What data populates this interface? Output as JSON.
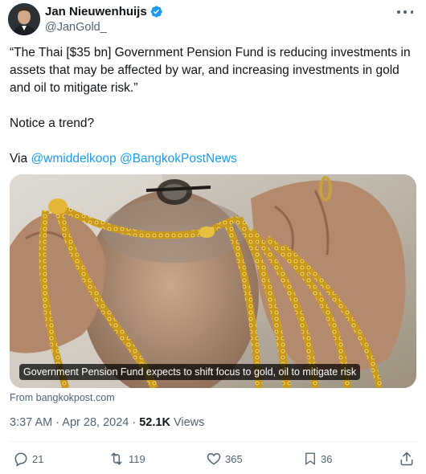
{
  "author": {
    "name": "Jan Nieuwenhuijs",
    "handle": "@JanGold_",
    "verified": true
  },
  "tweet": {
    "quote": "“The Thai [$35 bn] Government Pension Fund is reducing investments in assets that may be affected by war, and increasing investments in gold and oil to mitigate risk.”",
    "line2": "Notice a trend?",
    "via_prefix": "Via ",
    "mentions": [
      "@wmiddelkoop",
      "@BangkokPostNews"
    ]
  },
  "media": {
    "caption": "Government Pension Fund expects to shift focus to gold, oil to mitigate risk",
    "source": "From bangkokpost.com"
  },
  "meta": {
    "time": "3:37 AM · Apr 28, 2024 · ",
    "views_count": "52.1K",
    "views_label": " Views"
  },
  "actions": {
    "replies": "21",
    "reposts": "119",
    "likes": "365",
    "bookmarks": "36"
  },
  "colors": {
    "accent": "#1d9bf0",
    "secondary_text": "#536471",
    "primary_text": "#0f1419"
  }
}
